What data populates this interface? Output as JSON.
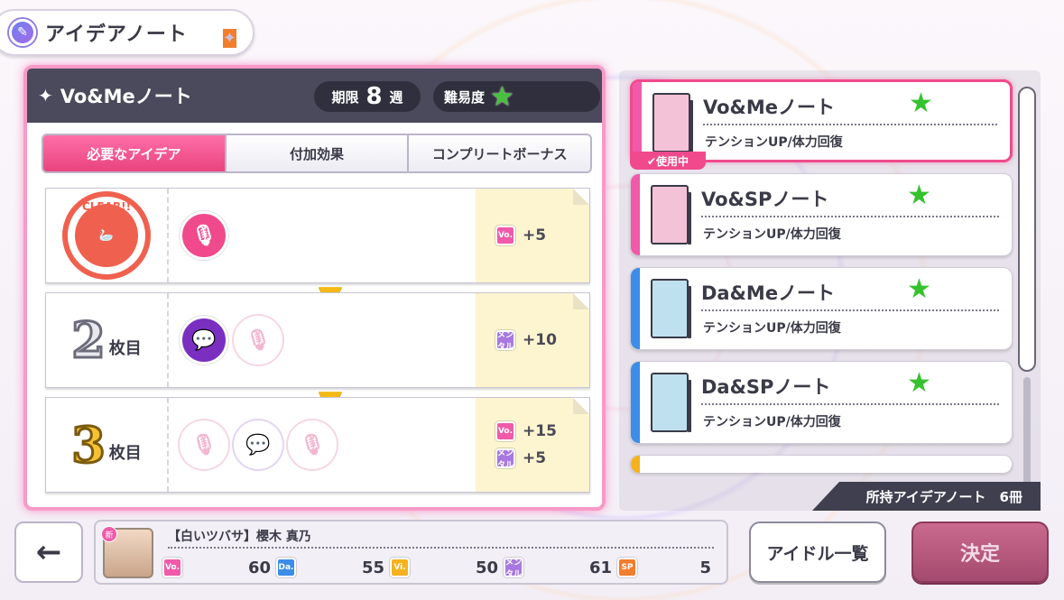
{
  "header": {
    "title": "アイデアノート"
  },
  "note": {
    "name": "Vo&Meノート",
    "deadline_label": "期限",
    "deadline_value": "8",
    "deadline_unit": "週",
    "difficulty_label": "難易度"
  },
  "tabs": [
    "必要なアイデア",
    "付加効果",
    "コンプリートボーナス"
  ],
  "rows": [
    {
      "label_num": "",
      "label_suffix": "",
      "clear_text": "CLEAR!!",
      "bonuses": [
        {
          "icon": "Vo.",
          "value": "+5"
        }
      ]
    },
    {
      "label_num": "2",
      "label_suffix": "枚目",
      "bonuses": [
        {
          "icon": "メンタル",
          "value": "+10"
        }
      ]
    },
    {
      "label_num": "3",
      "label_suffix": "枚目",
      "bonuses": [
        {
          "icon": "Vo.",
          "value": "+15"
        },
        {
          "icon": "メンタル",
          "value": "+5"
        }
      ]
    }
  ],
  "notes_list": [
    {
      "title": "Vo&Meノート",
      "desc": "テンションUP/体力回復",
      "color": "#f05aa8",
      "in_use": true
    },
    {
      "title": "Vo&SPノート",
      "desc": "テンションUP/体力回復",
      "color": "#f05aa8",
      "in_use": false
    },
    {
      "title": "Da&Meノート",
      "desc": "テンションUP/体力回復",
      "color": "#3b8de8",
      "in_use": false
    },
    {
      "title": "Da&SPノート",
      "desc": "テンションUP/体力回復",
      "color": "#3b8de8",
      "in_use": false
    }
  ],
  "in_use_label": "✔使用中",
  "owned_label": "所持アイデアノート　6冊",
  "idol": {
    "name": "【白いツバサ】櫻木 真乃",
    "stats": [
      {
        "icon": "Vo.",
        "value": "60"
      },
      {
        "icon": "Da.",
        "value": "55"
      },
      {
        "icon": "Vi.",
        "value": "50"
      },
      {
        "icon": "メンタル",
        "value": "61"
      },
      {
        "icon": "SP",
        "value": "5"
      }
    ]
  },
  "buttons": {
    "back": "←",
    "idol_list": "アイドル一覧",
    "decide": "決定"
  },
  "colors": {
    "accent": "#f04a8c",
    "star": "#36c22e",
    "clear": "#f0604e"
  }
}
